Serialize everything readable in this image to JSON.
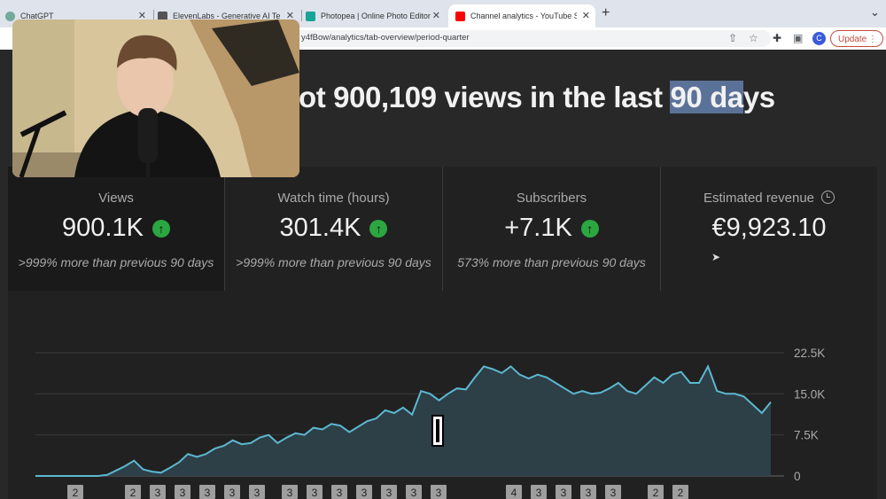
{
  "browser": {
    "tabs": [
      {
        "title": "ChatGPT",
        "color": "#74aa9c"
      },
      {
        "title": "ElevenLabs - Generative AI Te",
        "color": "#555555"
      },
      {
        "title": "Photopea | Online Photo Editor",
        "color": "#18a497"
      },
      {
        "title": "Channel analytics - YouTube St",
        "color": "#ff0000",
        "active": true
      }
    ],
    "url": "y4fBow/analytics/tab-overview/period-quarter",
    "account_initial": "C",
    "update_label": "Update"
  },
  "headline": {
    "text": "ot 900,109 views in the last ",
    "highlight": "90 da",
    "tail": "ys"
  },
  "metrics": [
    {
      "label": "Views",
      "value": "900.1K",
      "trend": "up",
      "comparison": ">999% more than previous 90 days"
    },
    {
      "label": "Watch time (hours)",
      "value": "301.4K",
      "trend": "up",
      "comparison": ">999% more than previous 90 days"
    },
    {
      "label": "Subscribers",
      "value": "+7.1K",
      "trend": "up",
      "comparison": "573% more than previous 90 days"
    },
    {
      "label": "Estimated revenue",
      "value": "€9,923.10",
      "icon": "clock-icon"
    }
  ],
  "chart_data": {
    "type": "area",
    "series": [
      {
        "values": [
          0,
          0,
          0,
          0,
          0,
          0,
          0,
          0,
          200,
          1000,
          1800,
          2800,
          1200,
          800,
          600,
          1500,
          2500,
          4000,
          3500,
          4000,
          5000,
          5500,
          6500,
          5800,
          6000,
          7000,
          7500,
          6000,
          7000,
          7800,
          7500,
          8800,
          8500,
          9500,
          9200,
          8000,
          9000,
          10000,
          10500,
          12000,
          11500,
          12500,
          11200,
          15500,
          15000,
          13800,
          15000,
          16000,
          15800,
          18000,
          20000,
          19500,
          18800,
          20000,
          18500,
          17800,
          18500,
          18000,
          17000,
          16000,
          15000,
          15500,
          15000,
          15200,
          16000,
          17000,
          15500,
          15000,
          16500,
          18000,
          17000,
          18500,
          19000,
          17000,
          17000,
          20000,
          15500,
          15000,
          15000,
          14500,
          13000,
          11500,
          13500
        ]
      }
    ],
    "ylim": [
      0,
      22500
    ],
    "yticks": [
      "22.5K",
      "15.0K",
      "7.5K",
      "0"
    ],
    "accent_color": "#5cb8d1",
    "fill_color": "#2d3f47"
  },
  "upload_markers": [
    "2",
    "2",
    "3",
    "3",
    "3",
    "3",
    "3",
    "3",
    "3",
    "3",
    "3",
    "3",
    "3",
    "3",
    "4",
    "3",
    "3",
    "3",
    "3",
    "3",
    "2",
    "2"
  ]
}
